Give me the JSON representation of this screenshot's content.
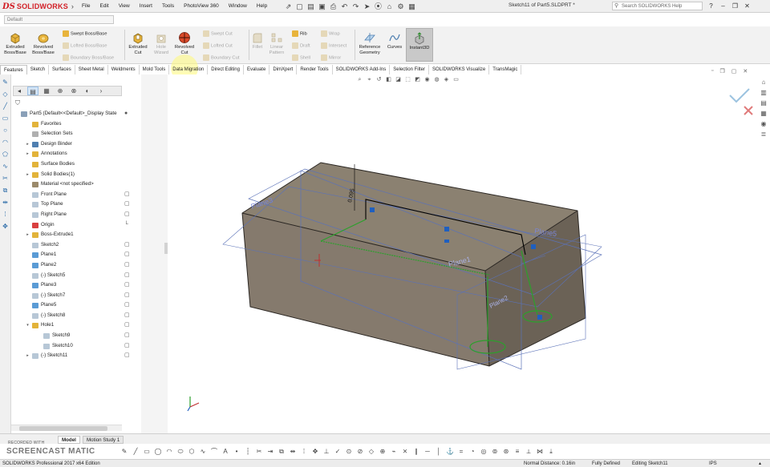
{
  "app": {
    "logo_ds": "DS",
    "logo_name": "SOLIDWORKS",
    "doc_title": "Sketch11 of Part5.SLDPRT *"
  },
  "menu": [
    "File",
    "Edit",
    "View",
    "Insert",
    "Tools",
    "PhotoView 360",
    "Window",
    "Help"
  ],
  "help_search": {
    "placeholder": "Search SOLIDWORKS Help"
  },
  "config_select": {
    "value": "Default"
  },
  "ribbon": {
    "extruded_boss": "Extruded Boss/Base",
    "revolved_boss": "Revolved Boss/Base",
    "swept_boss": "Swept Boss/Base",
    "lofted_boss": "Lofted Boss/Base",
    "boundary_boss": "Boundary Boss/Base",
    "extruded_cut": "Extruded Cut",
    "hole_wizard": "Hole Wizard",
    "revolved_cut": "Revolved Cut",
    "swept_cut": "Swept Cut",
    "lofted_cut": "Lofted Cut",
    "boundary_cut": "Boundary Cut",
    "fillet": "Fillet",
    "linear_pattern": "Linear Pattern",
    "rib": "Rib",
    "draft": "Draft",
    "shell": "Shell",
    "wrap": "Wrap",
    "intersect": "Intersect",
    "mirror": "Mirror",
    "reference_geometry": "Reference Geometry",
    "curves": "Curves",
    "instant3d": "Instant3D"
  },
  "tabs": [
    "Features",
    "Sketch",
    "Surfaces",
    "Sheet Metal",
    "Weldments",
    "Mold Tools",
    "Data Migration",
    "Direct Editing",
    "Evaluate",
    "DimXpert",
    "Render Tools",
    "SOLIDWORKS Add-Ins",
    "Selection Filter",
    "SOLIDWORKS Visualize",
    "TransMagic"
  ],
  "tree": [
    {
      "label": "Part5  (Default<<Default>_Display State",
      "indent": 0,
      "exp": "",
      "color": "#8aa0b8"
    },
    {
      "label": "Favorites",
      "indent": 1,
      "exp": "",
      "color": "#e2b33a"
    },
    {
      "label": "Selection Sets",
      "indent": 1,
      "exp": "",
      "color": "#b0b0b0"
    },
    {
      "label": "Design Binder",
      "indent": 1,
      "exp": "▸",
      "color": "#4f7fb0"
    },
    {
      "label": "Annotations",
      "indent": 1,
      "exp": "▸",
      "color": "#e2b33a"
    },
    {
      "label": "Surface Bodies",
      "indent": 1,
      "exp": "",
      "color": "#e2b33a"
    },
    {
      "label": "Solid Bodies(1)",
      "indent": 1,
      "exp": "▸",
      "color": "#e2b33a"
    },
    {
      "label": "Material <not specified>",
      "indent": 1,
      "exp": "",
      "color": "#9b8a6a"
    },
    {
      "label": "Front Plane",
      "indent": 1,
      "exp": "",
      "color": "#b7c7d6"
    },
    {
      "label": "Top Plane",
      "indent": 1,
      "exp": "",
      "color": "#b7c7d6"
    },
    {
      "label": "Right Plane",
      "indent": 1,
      "exp": "",
      "color": "#b7c7d6"
    },
    {
      "label": "Origin",
      "indent": 1,
      "exp": "",
      "color": "#d94040"
    },
    {
      "label": "Boss-Extrude1",
      "indent": 1,
      "exp": "▸",
      "color": "#e2b33a"
    },
    {
      "label": "Sketch2",
      "indent": 1,
      "exp": "",
      "color": "#b7c7d6"
    },
    {
      "label": "Plane1",
      "indent": 1,
      "exp": "",
      "color": "#5a9bd5"
    },
    {
      "label": "Plane2",
      "indent": 1,
      "exp": "",
      "color": "#5a9bd5"
    },
    {
      "label": "(-) Sketch5",
      "indent": 1,
      "exp": "",
      "color": "#b7c7d6"
    },
    {
      "label": "Plane3",
      "indent": 1,
      "exp": "",
      "color": "#5a9bd5"
    },
    {
      "label": "(-) Sketch7",
      "indent": 1,
      "exp": "",
      "color": "#b7c7d6"
    },
    {
      "label": "Plane5",
      "indent": 1,
      "exp": "",
      "color": "#5a9bd5"
    },
    {
      "label": "(-) Sketch8",
      "indent": 1,
      "exp": "",
      "color": "#b7c7d6"
    },
    {
      "label": "Hole1",
      "indent": 1,
      "exp": "▾",
      "color": "#e2b33a"
    },
    {
      "label": "Sketch9",
      "indent": 2,
      "exp": "",
      "color": "#b7c7d6"
    },
    {
      "label": "Sketch10",
      "indent": 2,
      "exp": "",
      "color": "#b7c7d6"
    },
    {
      "label": "(-) Sketch11",
      "indent": 1,
      "exp": "▸",
      "color": "#b7c7d6"
    }
  ],
  "model": {
    "dim_label": "0.095",
    "plane_labels": [
      "Plane3",
      "Plane5",
      "Plane1",
      "Plane2"
    ]
  },
  "bottom_tabs": {
    "model": "Model",
    "motion": "Motion Study 1"
  },
  "recorder": {
    "small": "RECORDED WITH",
    "big": "SCREENCAST  MATIC"
  },
  "status": {
    "edition": "SOLIDWORKS Professional 2017 x64 Edition",
    "normal_distance": "Normal Distance: 0.16in",
    "defined": "Fully Defined",
    "editing": "Editing Sketch11",
    "units": "IPS"
  }
}
